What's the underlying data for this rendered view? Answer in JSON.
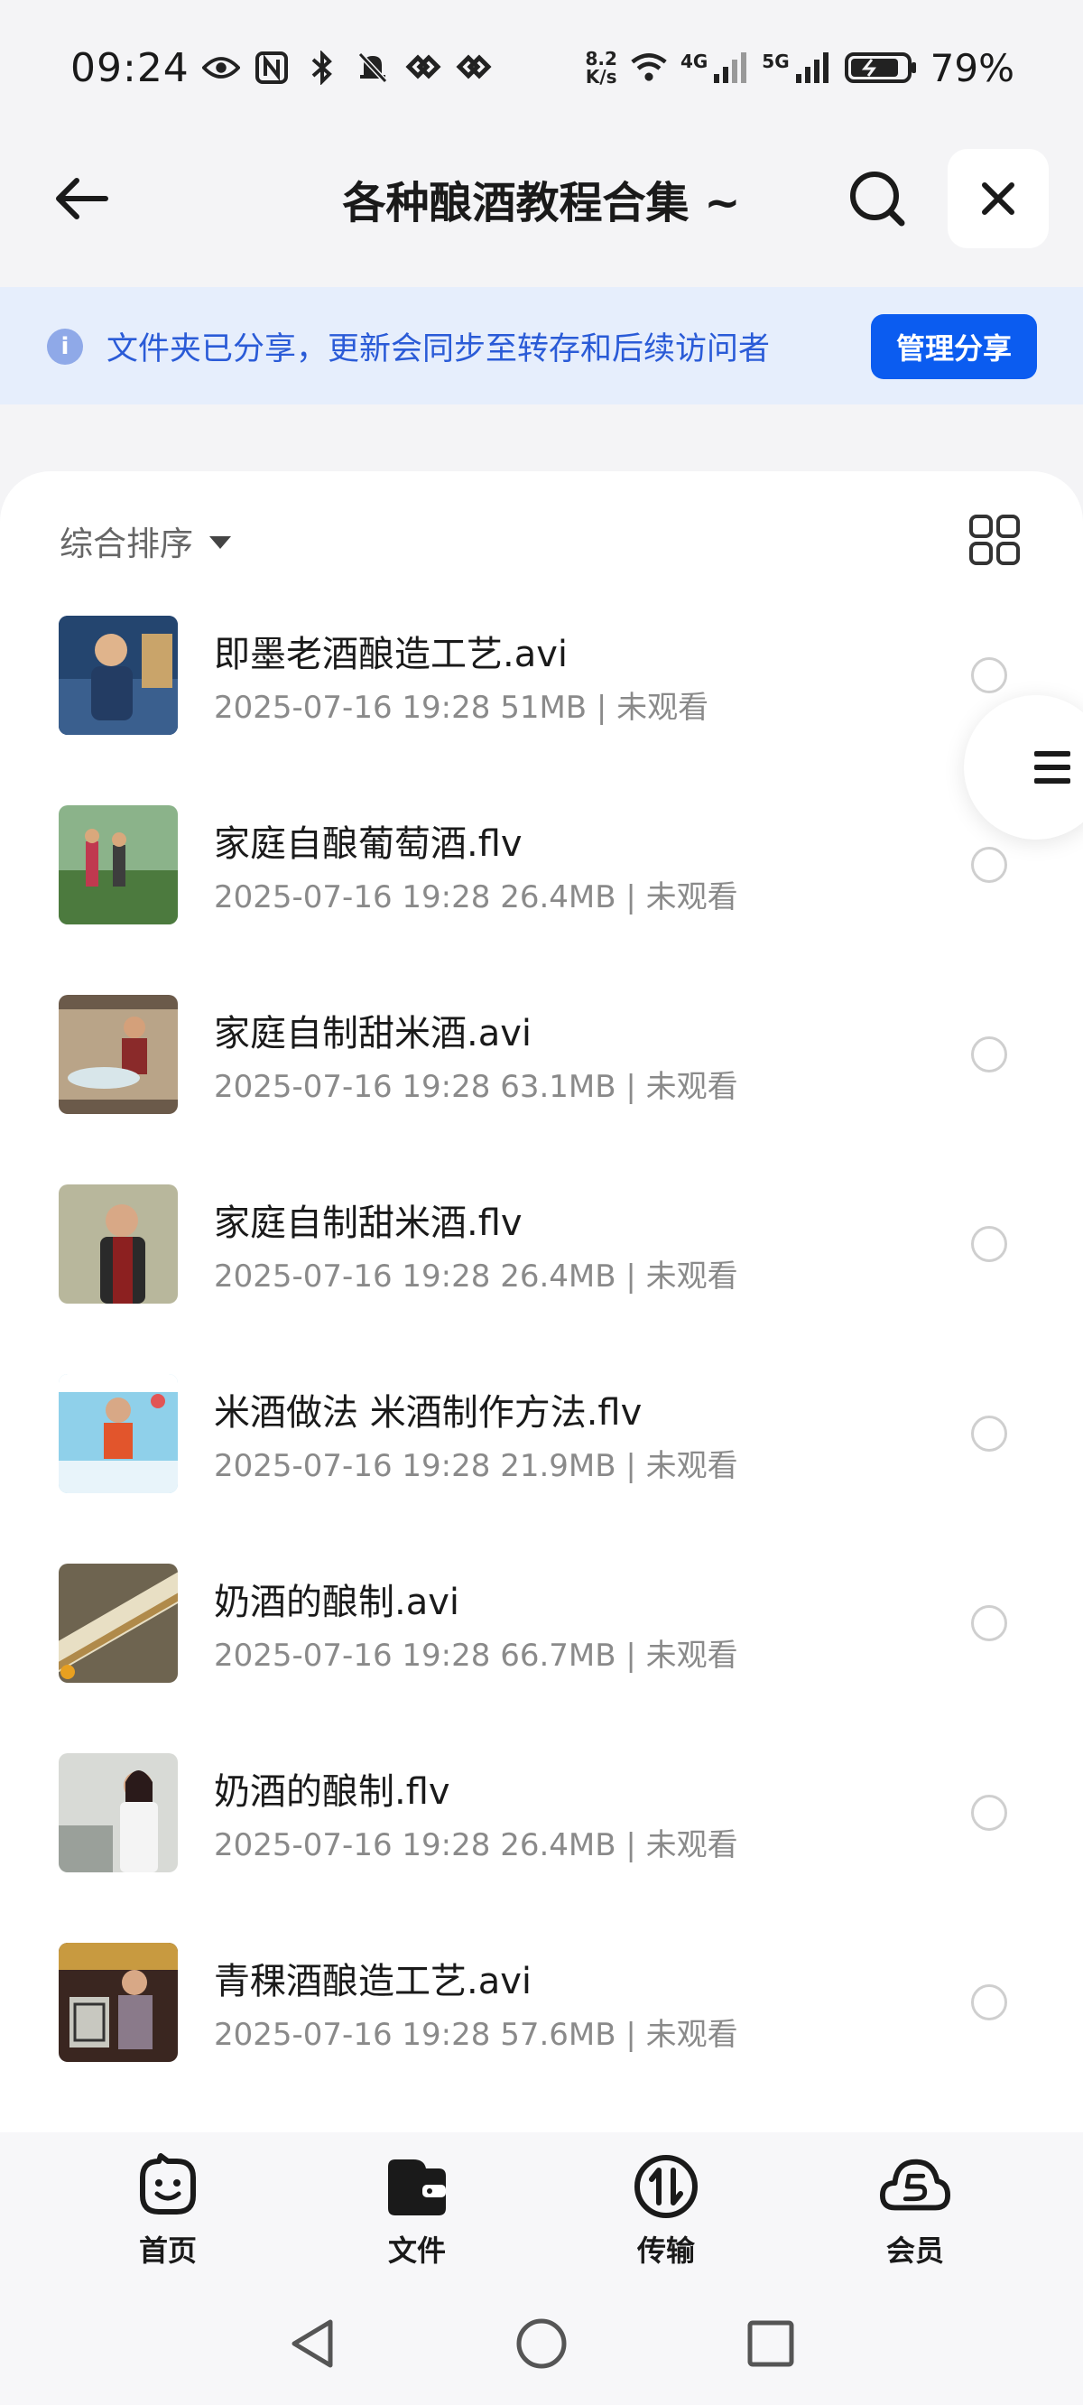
{
  "status_bar": {
    "time": "09:24",
    "net_speed_top": "8.2",
    "net_speed_bottom": "K/s",
    "network_4g": "4G",
    "network_5g": "5G",
    "battery": "79%"
  },
  "header": {
    "title": "各种酿酒教程合集 ~"
  },
  "share_banner": {
    "text": "文件夹已分享，更新会同步至转存和后续访问者",
    "button_label": "管理分享"
  },
  "sort": {
    "label": "综合排序"
  },
  "files": [
    {
      "name": "即墨老酒酿造工艺.avi",
      "meta": "2025-07-16 19:28  51MB | 未观看",
      "thumb_color": "#2b4f8a"
    },
    {
      "name": "家庭自酿葡萄酒.flv",
      "meta": "2025-07-16 19:28  26.4MB | 未观看",
      "thumb_color": "#5d8a4a"
    },
    {
      "name": "家庭自制甜米酒.avi",
      "meta": "2025-07-16 19:28  63.1MB | 未观看",
      "thumb_color": "#9c8a6e"
    },
    {
      "name": "家庭自制甜米酒.flv",
      "meta": "2025-07-16 19:28  26.4MB | 未观看",
      "thumb_color": "#a8a78a"
    },
    {
      "name": "米酒做法 米酒制作方法.flv",
      "meta": "2025-07-16 19:28  21.9MB | 未观看",
      "thumb_color": "#6cb6d8"
    },
    {
      "name": "奶酒的酿制.avi",
      "meta": "2025-07-16 19:28  66.7MB | 未观看",
      "thumb_color": "#b7ad8e"
    },
    {
      "name": "奶酒的酿制.flv",
      "meta": "2025-07-16 19:28  26.4MB | 未观看",
      "thumb_color": "#c9cbc9"
    },
    {
      "name": "青稞酒酿造工艺.avi",
      "meta": "2025-07-16 19:28  57.6MB | 未观看",
      "thumb_color": "#8a6a5a"
    }
  ],
  "bottom_nav": {
    "items": [
      {
        "label": "首页",
        "icon": "smile-face-icon"
      },
      {
        "label": "文件",
        "icon": "folder-icon"
      },
      {
        "label": "传输",
        "icon": "transfer-icon"
      },
      {
        "label": "会员",
        "icon": "cloud-vip-icon"
      }
    ]
  },
  "colors": {
    "accent": "#0b5cf0",
    "banner_bg": "#e6eefc",
    "banner_text": "#2a5bd7"
  }
}
